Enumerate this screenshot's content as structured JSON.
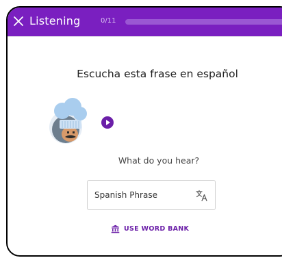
{
  "header": {
    "title": "Listening",
    "progress_text": "0/11",
    "progress_fraction": 0,
    "accent_color": "#7a1fc0"
  },
  "exercise": {
    "prompt": "Escucha esta frase en español",
    "question": "What do you hear?",
    "answer_placeholder": "Spanish Phrase",
    "answer_value": "",
    "word_bank_label": "USE WORD BANK"
  },
  "icons": {
    "close": "close-icon",
    "play": "play-icon",
    "translate": "translate-icon",
    "bank": "bank-icon",
    "avatar": "chef-avatar"
  }
}
